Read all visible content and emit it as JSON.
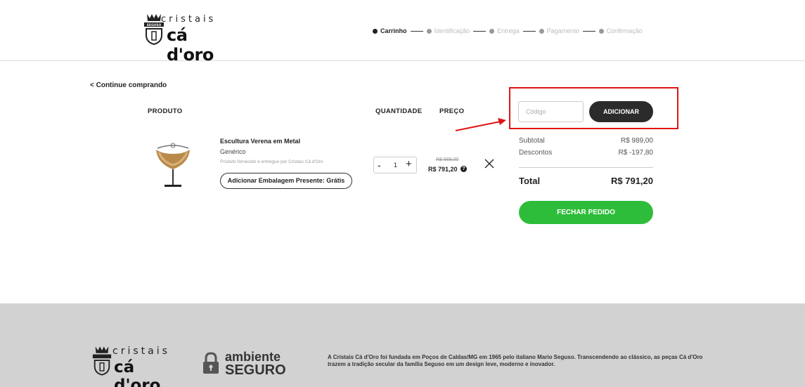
{
  "header": {
    "logo_small": "cristais",
    "logo_big": "cá d'oro",
    "logo_seal": "SEGUSO",
    "steps": [
      {
        "label": "Carrinho",
        "active": true
      },
      {
        "label": "Identificação",
        "active": false
      },
      {
        "label": "Entrega",
        "active": false
      },
      {
        "label": "Pagamento",
        "active": false
      },
      {
        "label": "Confirmação",
        "active": false
      }
    ]
  },
  "cart": {
    "back_link": "< Continue comprando",
    "columns": {
      "product": "PRODUTO",
      "quantity": "QUANTIDADE",
      "price": "PREÇO"
    },
    "item": {
      "name": "Escultura Verena em Metal",
      "brand": "Genérico",
      "seller": "Produto fornecido e entregue por Cristais Cá d'Oro",
      "gift_button": "Adicionar Embalagem Presente: Grátis",
      "quantity": "1",
      "minus": "-",
      "plus": "+",
      "old_price": "R$ 989,00",
      "new_price": "R$ 791,20",
      "help_icon": "?"
    }
  },
  "summary": {
    "coupon_placeholder": "Código",
    "add_button": "ADICIONAR",
    "subtotal_label": "Subtotal",
    "subtotal_value": "R$ 989,00",
    "discount_label": "Descontos",
    "discount_value": "R$ -197,80",
    "total_label": "Total",
    "total_value": "R$ 791,20",
    "checkout_button": "FECHAR PEDIDO"
  },
  "footer": {
    "logo_small": "cristais",
    "logo_big": "cá d'oro",
    "secure_line1": "ambiente",
    "secure_line2": "SEGURO",
    "about_text": "A Cristais Cá d'Oro foi fundada em Poços de Caldas/MG em 1965 pelo italiano Mario Seguso. Transcendendo ao clássico, as peças Cá d'Oro trazem a tradição secular da família Seguso em um design leve, moderno e inovador."
  },
  "colors": {
    "accent_green": "#2ebd3a",
    "dark_button": "#2b2b2b",
    "highlight_red": "#e01414",
    "footer_bg": "#d2d2d2"
  }
}
